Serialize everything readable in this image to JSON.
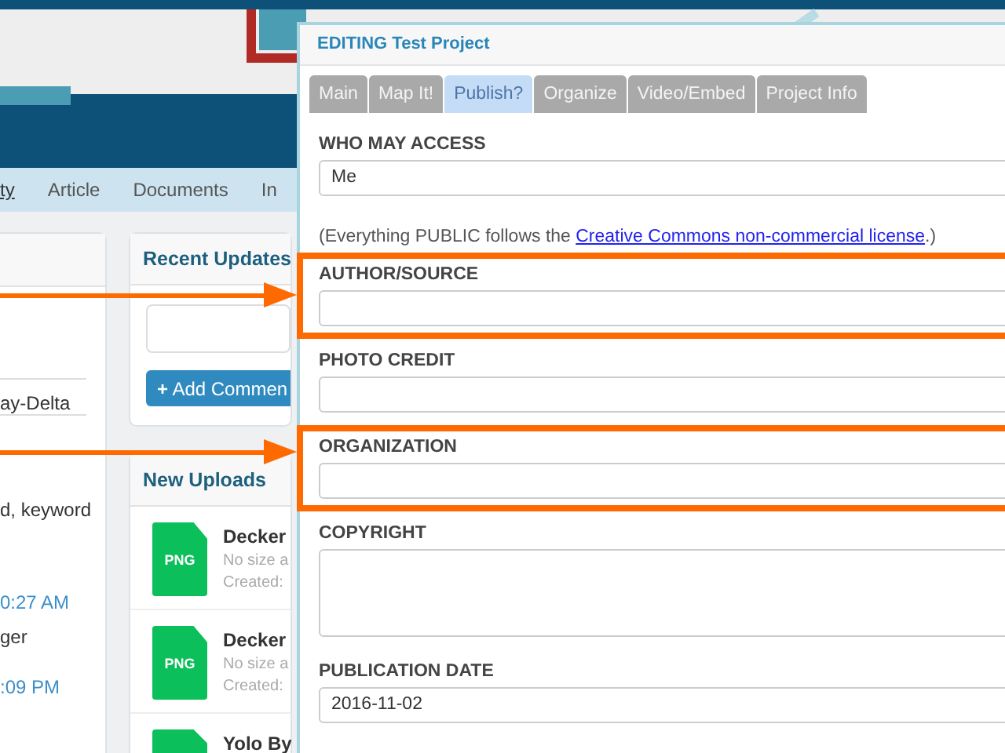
{
  "page": {
    "nav": [
      {
        "label": "ty",
        "selected": true
      },
      {
        "label": "Article",
        "selected": false
      },
      {
        "label": "Documents",
        "selected": false
      },
      {
        "label": "In",
        "selected": false
      }
    ],
    "left_panel": {
      "lines": [
        {
          "kind": "text",
          "text": "ay-Delta"
        },
        {
          "kind": "divider"
        },
        {
          "kind": "text",
          "text": "d, keyword"
        },
        {
          "kind": "time",
          "text": "0:27 AM"
        },
        {
          "kind": "text",
          "text": "ger"
        },
        {
          "kind": "time",
          "text": ":09 PM"
        }
      ]
    },
    "recent_updates": {
      "title": "Recent Updates",
      "button_icon": "+",
      "button": "Add Commen"
    },
    "new_uploads": {
      "title": "New Uploads",
      "items": [
        {
          "badge": "PNG",
          "name": "Decker",
          "size": "No size a",
          "created": "Created:"
        },
        {
          "badge": "PNG",
          "name": "Decker",
          "size": "No size a",
          "created": "Created:"
        },
        {
          "name": "Yolo By"
        }
      ]
    }
  },
  "modal": {
    "title": "EDITING Test Project",
    "tabs": [
      {
        "label": "Main",
        "selected": false
      },
      {
        "label": "Map It!",
        "selected": false
      },
      {
        "label": "Publish?",
        "selected": true
      },
      {
        "label": "Organize",
        "selected": false
      },
      {
        "label": "Video/Embed",
        "selected": false
      },
      {
        "label": "Project Info",
        "selected": false
      }
    ],
    "fields": [
      {
        "kind": "input",
        "label": "WHO MAY ACCESS",
        "value": "Me",
        "highlighted": false
      },
      {
        "kind": "note",
        "before": "(Everything PUBLIC follows the ",
        "link": "Creative Commons non-commercial license",
        "after": ".)"
      },
      {
        "kind": "input",
        "label": "AUTHOR/SOURCE",
        "highlighted": true
      },
      {
        "kind": "input",
        "label": "PHOTO CREDIT",
        "highlighted": false
      },
      {
        "kind": "input",
        "label": "ORGANIZATION",
        "highlighted": true
      },
      {
        "kind": "textarea",
        "label": "COPYRIGHT",
        "highlighted": false
      },
      {
        "kind": "input",
        "label": "PUBLICATION DATE",
        "value": "2016-11-02",
        "highlighted": false
      }
    ]
  }
}
